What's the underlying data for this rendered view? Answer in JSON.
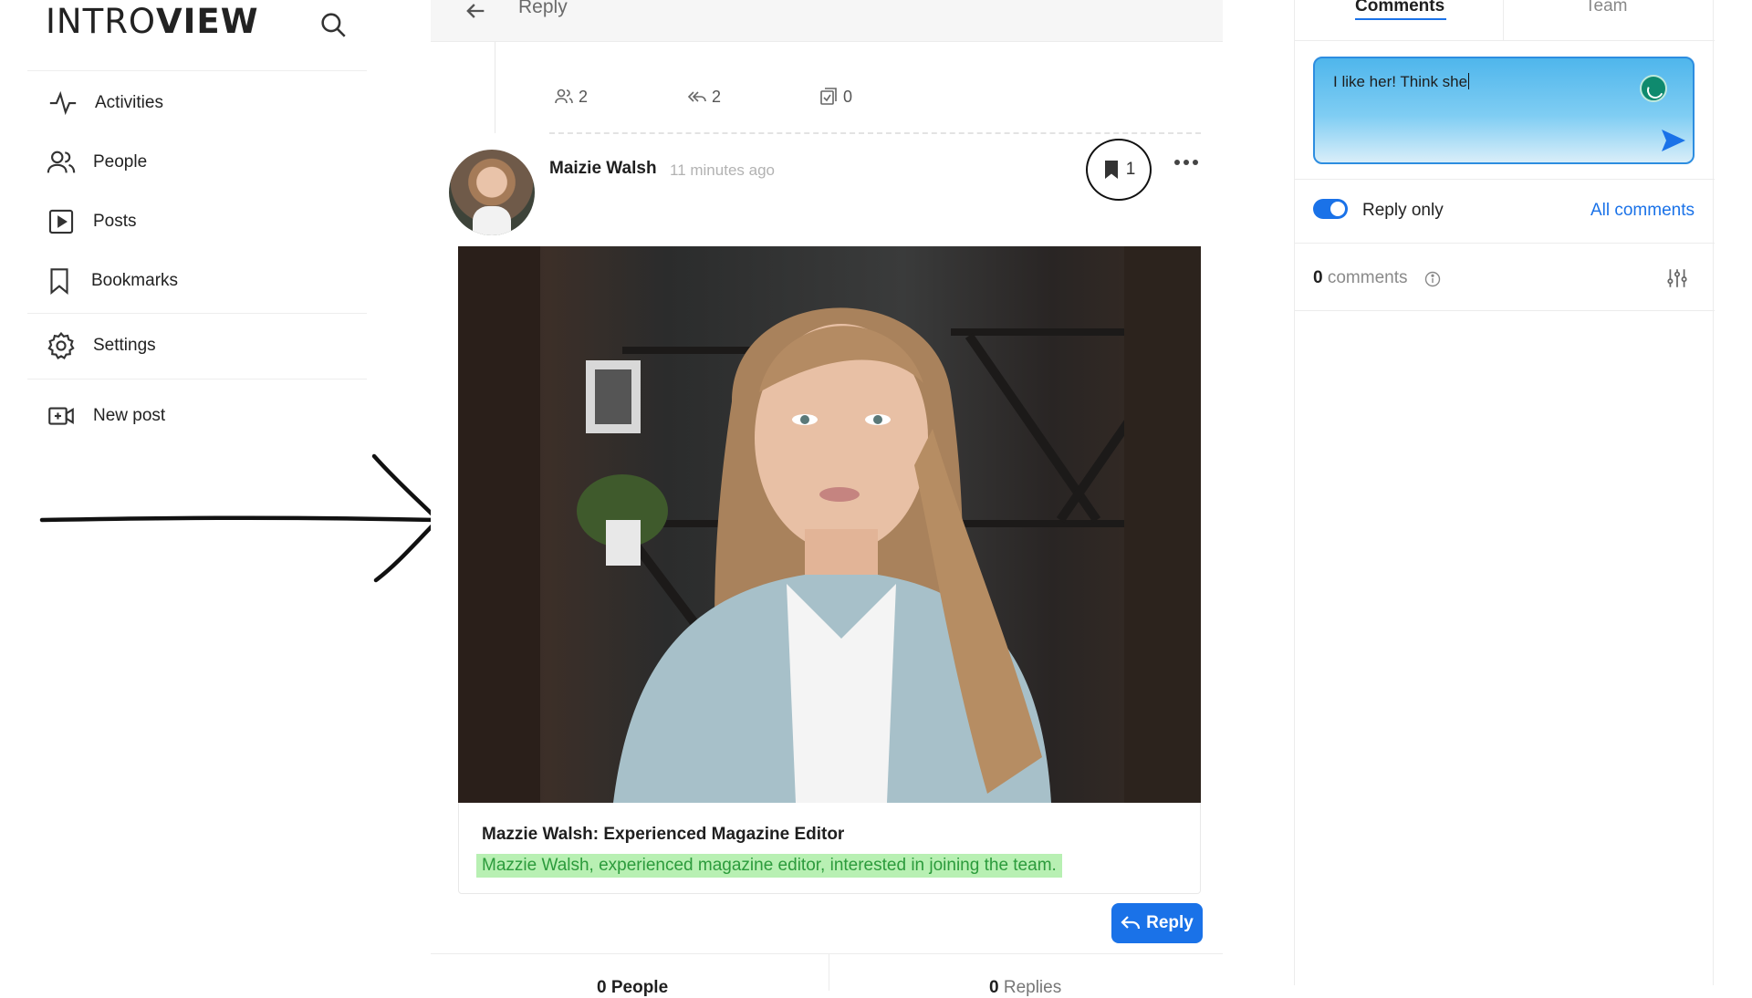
{
  "brand": {
    "logo_part1": "INTRO",
    "logo_part2": "VIEW"
  },
  "sidebar": {
    "items": [
      {
        "label": "Activities",
        "icon": "activity-icon"
      },
      {
        "label": "People",
        "icon": "people-icon"
      },
      {
        "label": "Posts",
        "icon": "play-square-icon"
      },
      {
        "label": "Bookmarks",
        "icon": "bookmark-icon"
      },
      {
        "label": "Settings",
        "icon": "gear-icon"
      },
      {
        "label": "New post",
        "icon": "video-add-icon"
      }
    ]
  },
  "feed": {
    "header_title": "Reply",
    "stats": {
      "people": "2",
      "replies": "2",
      "tasks": "0"
    },
    "post": {
      "author": "Maizie Walsh",
      "time": "11 minutes ago",
      "bookmark_count": "1",
      "title": "Mazzie Walsh: Experienced Magazine Editor",
      "description": "Mazzie Walsh, experienced magazine editor, interested in joining the team.",
      "reply_label": "Reply"
    },
    "bottom_tabs": {
      "people_count": "0",
      "people_label": "People",
      "replies_count": "0",
      "replies_label": "Replies"
    }
  },
  "panel": {
    "tabs": {
      "comments": "Comments",
      "team": "Team"
    },
    "comment_input_value": "I like her! Think she",
    "reply_only_label": "Reply only",
    "all_comments_label": "All comments",
    "comment_count": "0",
    "comment_count_label": "comments"
  },
  "colors": {
    "accent": "#1a72e8",
    "highlight": "#b8f0b3",
    "highlight_text": "#2c9b3c"
  }
}
